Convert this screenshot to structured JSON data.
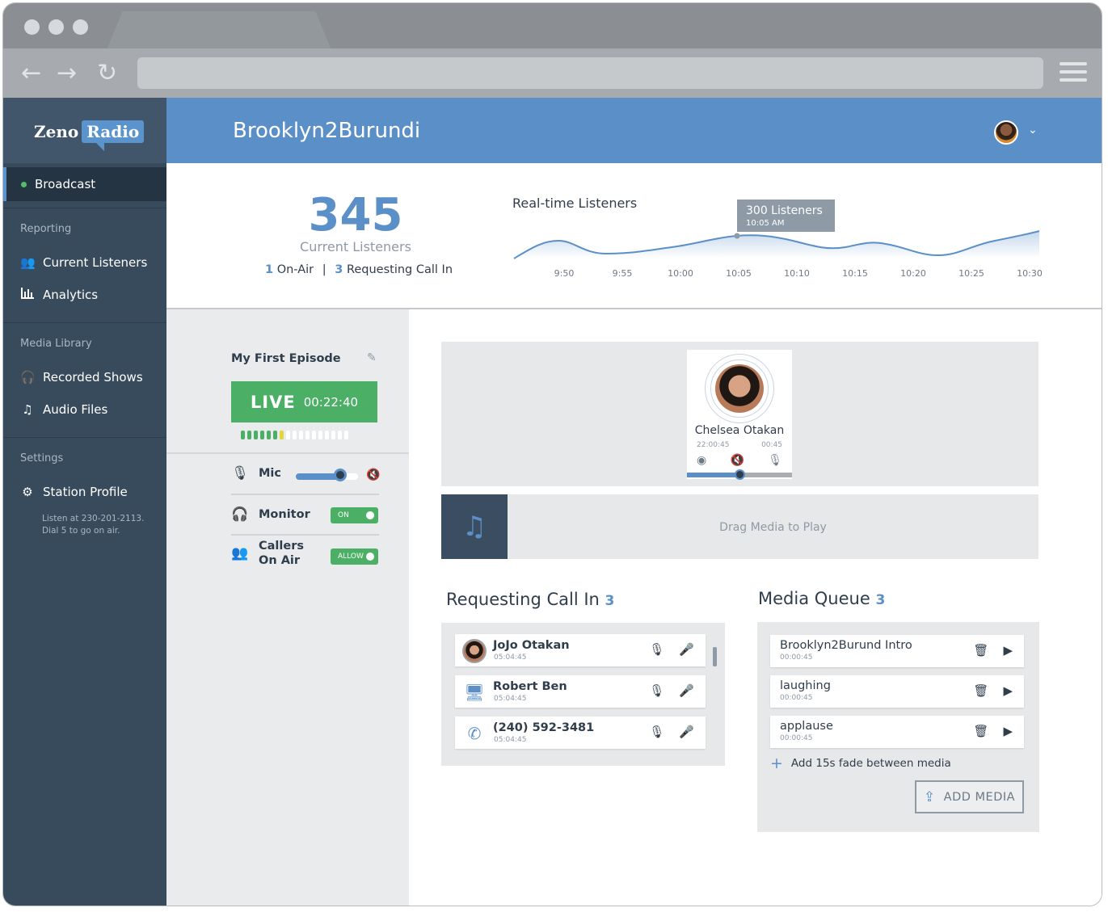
{
  "app": {
    "logo_left": "Zeno",
    "logo_right": "Radio",
    "station_title": "Brooklyn2Burundi"
  },
  "sidebar": {
    "active_item": "Broadcast",
    "sections": [
      {
        "title": "Reporting",
        "items": [
          {
            "label": "Current Listeners",
            "icon": "users-icon"
          },
          {
            "label": "Analytics",
            "icon": "bar-chart-icon"
          }
        ]
      },
      {
        "title": "Media Library",
        "items": [
          {
            "label": "Recorded Shows",
            "icon": "recorded-shows-icon"
          },
          {
            "label": "Audio Files",
            "icon": "music-file-icon"
          }
        ]
      },
      {
        "title": "Settings",
        "items": [
          {
            "label": "Station Profile",
            "icon": "gear-icon"
          }
        ]
      }
    ],
    "listen_note_1": "Listen at 230-201-2113.",
    "listen_note_2": "Dial 5 to go on air."
  },
  "stats": {
    "current_listeners": "345",
    "current_listeners_label": "Current Listeners",
    "on_air_count": "1",
    "on_air_label": "On-Air",
    "divider": "|",
    "requesting_count": "3",
    "requesting_label": "Requesting Call In"
  },
  "chart_data": {
    "type": "area",
    "title": "Real-time Listeners",
    "x": [
      "9:50",
      "9:55",
      "10:00",
      "10:05",
      "10:10",
      "10:15",
      "10:20",
      "10:25",
      "10:30"
    ],
    "tooltip": {
      "value": "300 Listeners",
      "time": "10:05 AM"
    },
    "tooltip_x": "10:05",
    "accent": "#5b8fc8"
  },
  "episode": {
    "title": "My First Episode",
    "live_label": "LIVE",
    "live_time": "00:22:40",
    "meter_green": 6,
    "meter_yellow": 1,
    "meter_total": 17
  },
  "controls": {
    "mic_label": "Mic",
    "mic_level": 0.72,
    "monitor_label": "Monitor",
    "monitor_toggle": "ON",
    "callers_label_1": "Callers",
    "callers_label_2": "On Air",
    "callers_toggle": "ALLOW"
  },
  "on_air_caller": {
    "name": "Chelsea Otakan",
    "time_start": "22:00:45",
    "time_elapsed": "00:45",
    "volume": 0.5
  },
  "drop_zone": {
    "text": "Drag Media to Play"
  },
  "requests": {
    "title": "Requesting Call In",
    "count": "3",
    "items": [
      {
        "name": "JoJo Otakan",
        "time": "05:04:45",
        "type": "avatar"
      },
      {
        "name": "Robert Ben",
        "time": "05:04:45",
        "type": "computer"
      },
      {
        "name": "(240) 592-3481",
        "time": "05:04:45",
        "type": "phone"
      }
    ]
  },
  "queue": {
    "title": "Media Queue",
    "count": "3",
    "items": [
      {
        "name": "Brooklyn2Burund Intro",
        "time": "00:00:45"
      },
      {
        "name": "laughing",
        "time": "00:00:45"
      },
      {
        "name": "applause",
        "time": "00:00:45"
      }
    ],
    "fade_label": "Add 15s fade between media",
    "add_media_label": "ADD MEDIA"
  }
}
